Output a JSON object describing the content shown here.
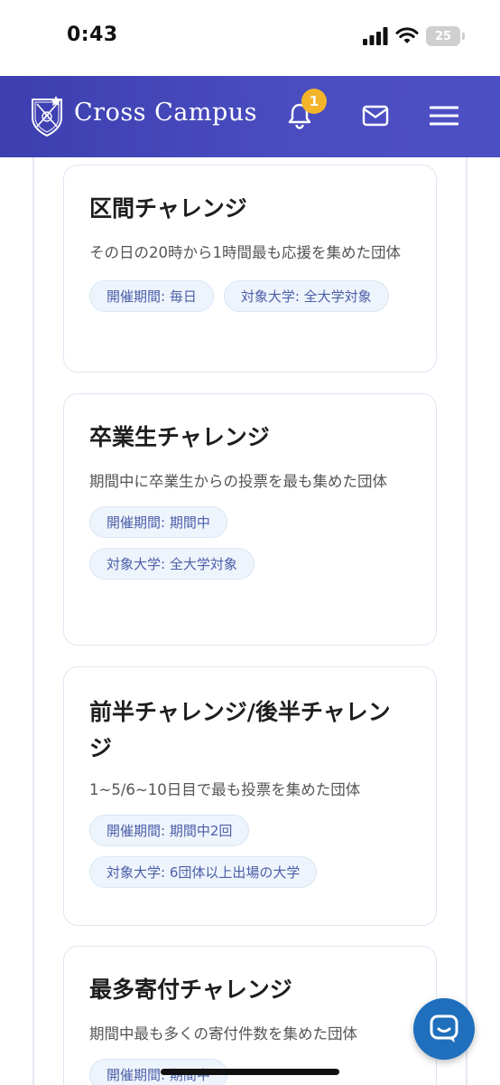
{
  "status_bar": {
    "time": "0:43",
    "battery": "25"
  },
  "header": {
    "brand": "Cross Campus",
    "notification_count": "1"
  },
  "cards": [
    {
      "title": "区間チャレンジ",
      "description": "その日の20時から1時間最も応援を集めた団体",
      "tags": [
        "開催期間: 毎日",
        "対象大学: 全大学対象"
      ]
    },
    {
      "title": "卒業生チャレンジ",
      "description": "期間中に卒業生からの投票を最も集めた団体",
      "tags": [
        "開催期間: 期間中",
        "対象大学: 全大学対象"
      ]
    },
    {
      "title": "前半チャレンジ/後半チャレンジ",
      "description": "1~5/6~10日目で最も投票を集めた団体",
      "tags": [
        "開催期間: 期間中2回",
        "対象大学: 6団体以上出場の大学"
      ]
    },
    {
      "title": "最多寄付チャレンジ",
      "description": "期間中最も多くの寄付件数を集めた団体",
      "tags": [
        "開催期間: 期間中"
      ]
    }
  ],
  "icons": {
    "bell": "bell-icon",
    "mail": "mail-icon",
    "menu": "hamburger-menu-icon",
    "chat": "chat-icon"
  },
  "colors": {
    "header_bg": "#4547bb",
    "badge": "#f4b42a",
    "tag_text": "#4b5ea8",
    "chat_fab": "#1f6fbd"
  }
}
